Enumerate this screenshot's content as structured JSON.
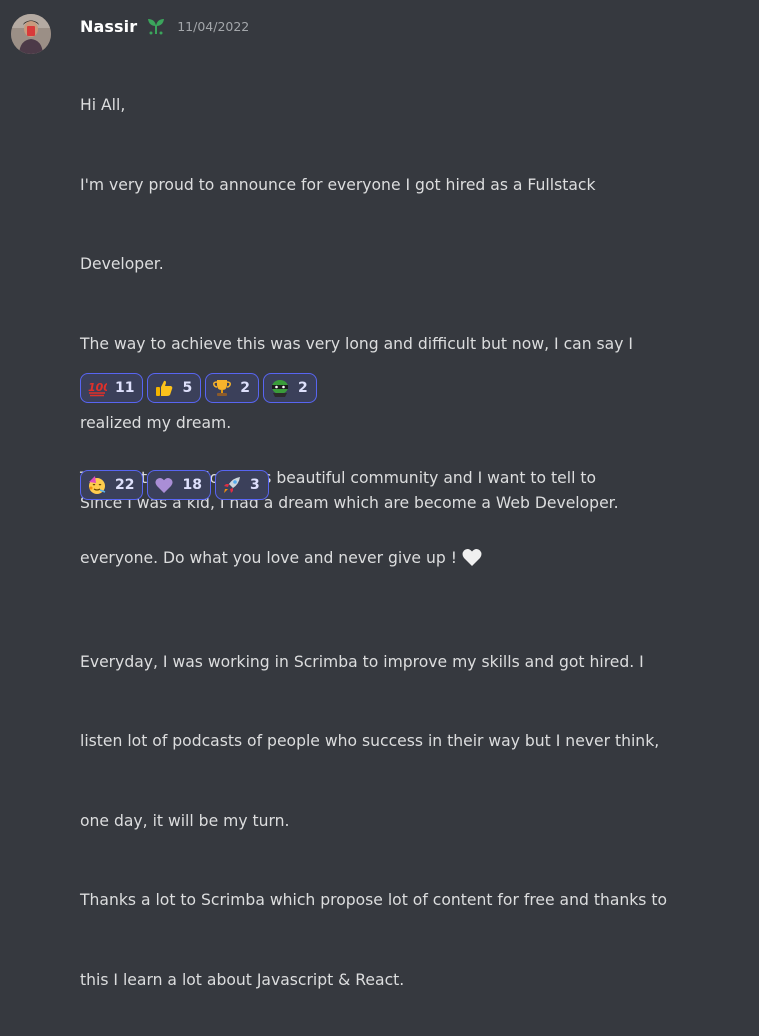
{
  "message": {
    "author": "Nassir",
    "timestamp": "11/04/2022",
    "role_icon": "sprout-icon",
    "first_block": [
      "Hi All,",
      "I'm very proud to announce for everyone I got hired as a Fullstack",
      "Developer.",
      "The way to achieve this was very long and difficult but now, I can say I",
      "realized my dream.",
      "Since I was a kid, I had a dream which are become a Web Developer.",
      "",
      "Everyday, I was working in Scrimba to improve my skills and got hired. I",
      "listen lot of podcasts of people who success in their way but I never think,",
      "one day, it will be my turn.",
      "Thanks a lot to Scrimba which propose lot of content for free and thanks to",
      "this I learn a lot about Javascript & React."
    ],
    "first_reactions": [
      {
        "emoji": "hundred-points-icon",
        "count": "11"
      },
      {
        "emoji": "thumbs-up-icon",
        "count": "5"
      },
      {
        "emoji": "trophy-icon",
        "count": "2"
      },
      {
        "emoji": "ninja-frog-icon",
        "count": "2"
      }
    ],
    "second_block": [
      "Thanks to All , I love this beautiful community and I want to tell to",
      "everyone. Do what you love and never give up !"
    ],
    "second_block_emoji": "white-heart-icon",
    "second_reactions": [
      {
        "emoji": "partying-face-icon",
        "count": "22"
      },
      {
        "emoji": "purple-heart-icon",
        "count": "18"
      },
      {
        "emoji": "rocket-icon",
        "count": "3"
      }
    ]
  },
  "colors": {
    "background": "#36393f",
    "text": "#dcddde",
    "username": "#ffffff",
    "timestamp": "#a3a6aa",
    "reaction_bg": "#3b405a",
    "reaction_border": "#5865f2"
  }
}
